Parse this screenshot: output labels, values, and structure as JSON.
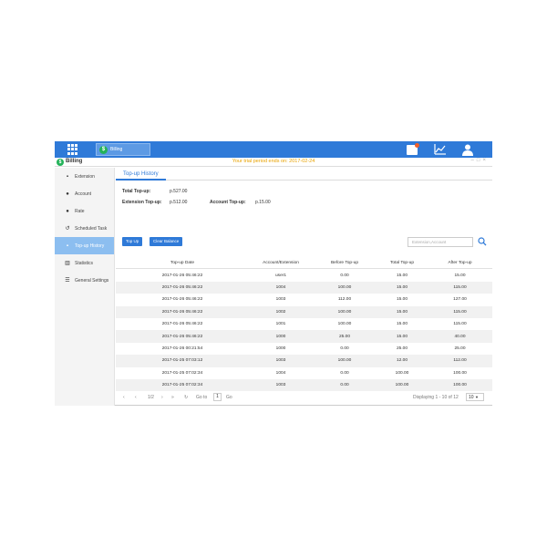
{
  "taskbar": {
    "app_tab_label": "Billing"
  },
  "window": {
    "title": "Billing",
    "trial_notice": "Your trial period ends on: 2017-02-24"
  },
  "sidebar": {
    "items": [
      {
        "label": "Extension",
        "icon": "extension-icon"
      },
      {
        "label": "Account",
        "icon": "user-icon"
      },
      {
        "label": "Rate",
        "icon": "rate-icon"
      },
      {
        "label": "Scheduled Task",
        "icon": "history-icon"
      },
      {
        "label": "Top-up History",
        "icon": "topup-icon"
      },
      {
        "label": "Statistics",
        "icon": "bar-chart-icon"
      },
      {
        "label": "General Settings",
        "icon": "list-icon"
      }
    ],
    "active_index": 4
  },
  "tab": {
    "label": "Top-up History"
  },
  "summary": {
    "total_label": "Total Top-up:",
    "total_value": "p.527.00",
    "ext_label": "Extension Top-up:",
    "ext_value": "p.512.00",
    "acct_label": "Account Top-up:",
    "acct_value": "p.15.00"
  },
  "buttons": {
    "top_up": "Top Up",
    "clear_balance": "Clear Balance"
  },
  "search": {
    "placeholder": "Extension,Account"
  },
  "table": {
    "columns": [
      "Top-up Date",
      "Account/Extension",
      "Before Top-up",
      "Total Top-up",
      "After Top-up"
    ],
    "rows": [
      [
        "2017-01-26 05:46:22",
        "user1",
        "0.00",
        "15.00",
        "15.00"
      ],
      [
        "2017-01-26 05:46:22",
        "1004",
        "100.00",
        "15.00",
        "115.00"
      ],
      [
        "2017-01-26 05:46:22",
        "1003",
        "112.00",
        "15.00",
        "127.00"
      ],
      [
        "2017-01-26 05:46:22",
        "1002",
        "100.00",
        "15.00",
        "115.00"
      ],
      [
        "2017-01-26 05:46:22",
        "1001",
        "100.00",
        "15.00",
        "115.00"
      ],
      [
        "2017-01-26 05:46:22",
        "1000",
        "25.00",
        "15.00",
        "40.00"
      ],
      [
        "2017-01-26 00:21:54",
        "1000",
        "0.00",
        "25.00",
        "25.00"
      ],
      [
        "2017-01-25 07:03:12",
        "1003",
        "100.00",
        "12.00",
        "112.00"
      ],
      [
        "2017-01-25 07:02:34",
        "1004",
        "0.00",
        "100.00",
        "100.00"
      ],
      [
        "2017-01-25 07:02:34",
        "1003",
        "0.00",
        "100.00",
        "100.00"
      ]
    ]
  },
  "pager": {
    "page_display": "1/2",
    "go_to_label": "Go to",
    "go_to_value": "1",
    "go_button": "Go",
    "displaying": "Displaying 1 - 10 of 12",
    "page_size": "10"
  }
}
